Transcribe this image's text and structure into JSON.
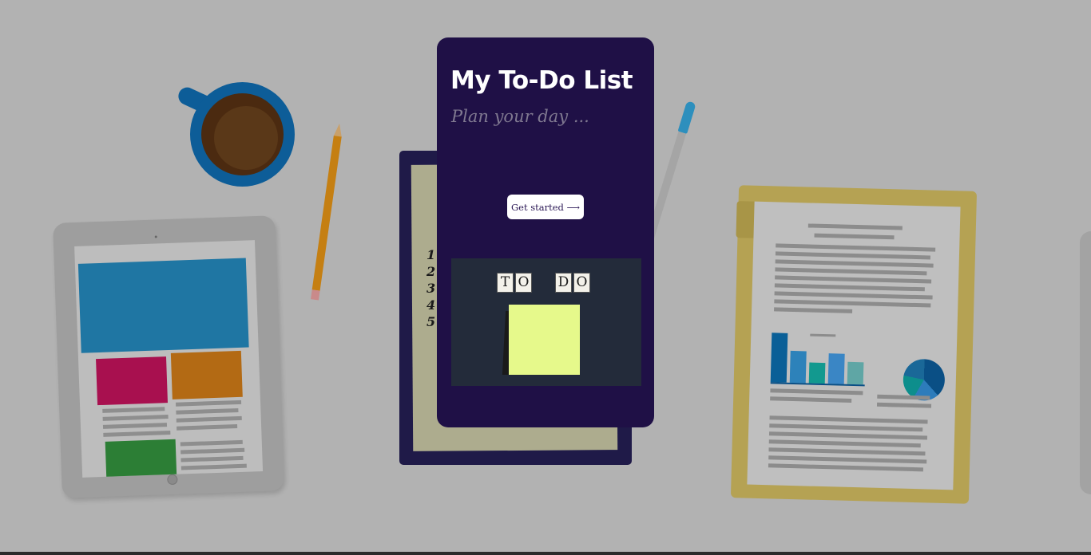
{
  "card": {
    "title": "My To-Do List",
    "subtitle": "Plan your day ...",
    "cta_label": "Get started ⟶"
  },
  "photo": {
    "tiles": [
      "T",
      "O",
      "D",
      "O"
    ]
  },
  "notebook": {
    "numbers": [
      "1",
      "2",
      "3",
      "4",
      "5"
    ]
  },
  "colors": {
    "background": "#b2b2b2",
    "card": "#1f1046",
    "button": "#ffffff",
    "sticky_note": "#e6f98b"
  }
}
